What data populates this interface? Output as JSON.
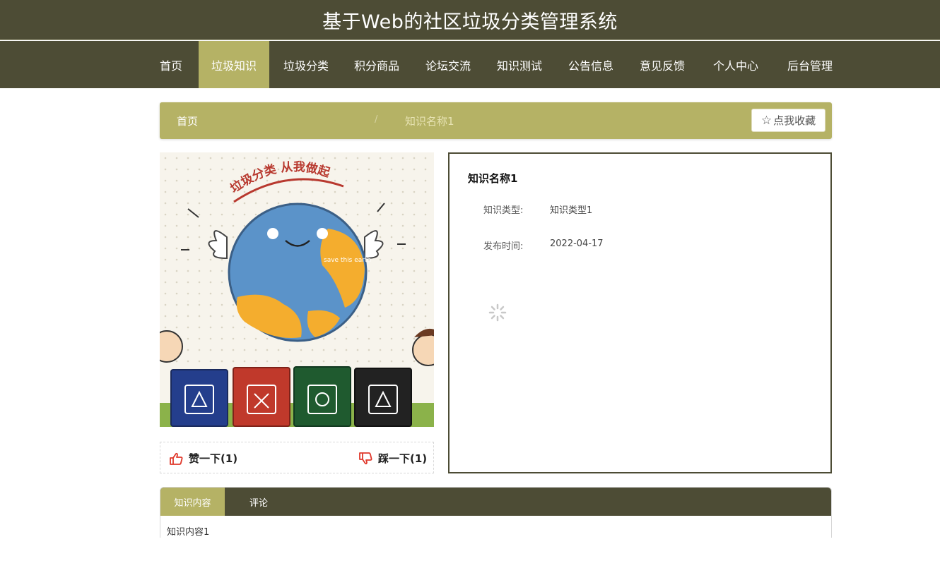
{
  "header": {
    "site_title": "基于Web的社区垃圾分类管理系统"
  },
  "nav": {
    "items": [
      "首页",
      "垃圾知识",
      "垃圾分类",
      "积分商品",
      "论坛交流",
      "知识测试",
      "公告信息",
      "意见反馈",
      "个人中心",
      "后台管理"
    ],
    "active": "垃圾知识"
  },
  "breadcrumb": {
    "home": "首页",
    "separator": "/",
    "current": "知识名称1"
  },
  "favorite_button": {
    "icon": "star-outline-icon",
    "label": "点我收藏"
  },
  "image": {
    "banner_text": "垃圾分类 从我做起",
    "globe_text": "save this earth"
  },
  "votes": {
    "like_label": "赞一下(1)",
    "like_icon": "thumbs-up-icon",
    "dislike_label": "踩一下(1)",
    "dislike_icon": "thumbs-down-icon"
  },
  "detail": {
    "title": "知识名称1",
    "fields": [
      {
        "label": "知识类型:",
        "value": "知识类型1"
      },
      {
        "label": "发布时间:",
        "value": "2022-04-17"
      }
    ]
  },
  "tabs": {
    "items": [
      "知识内容",
      "评论"
    ],
    "active": "知识内容",
    "content": "知识内容1"
  },
  "colors": {
    "header_bg": "#4d4c35",
    "accent": "#b5b265",
    "vote_icon": "#e0382b"
  }
}
